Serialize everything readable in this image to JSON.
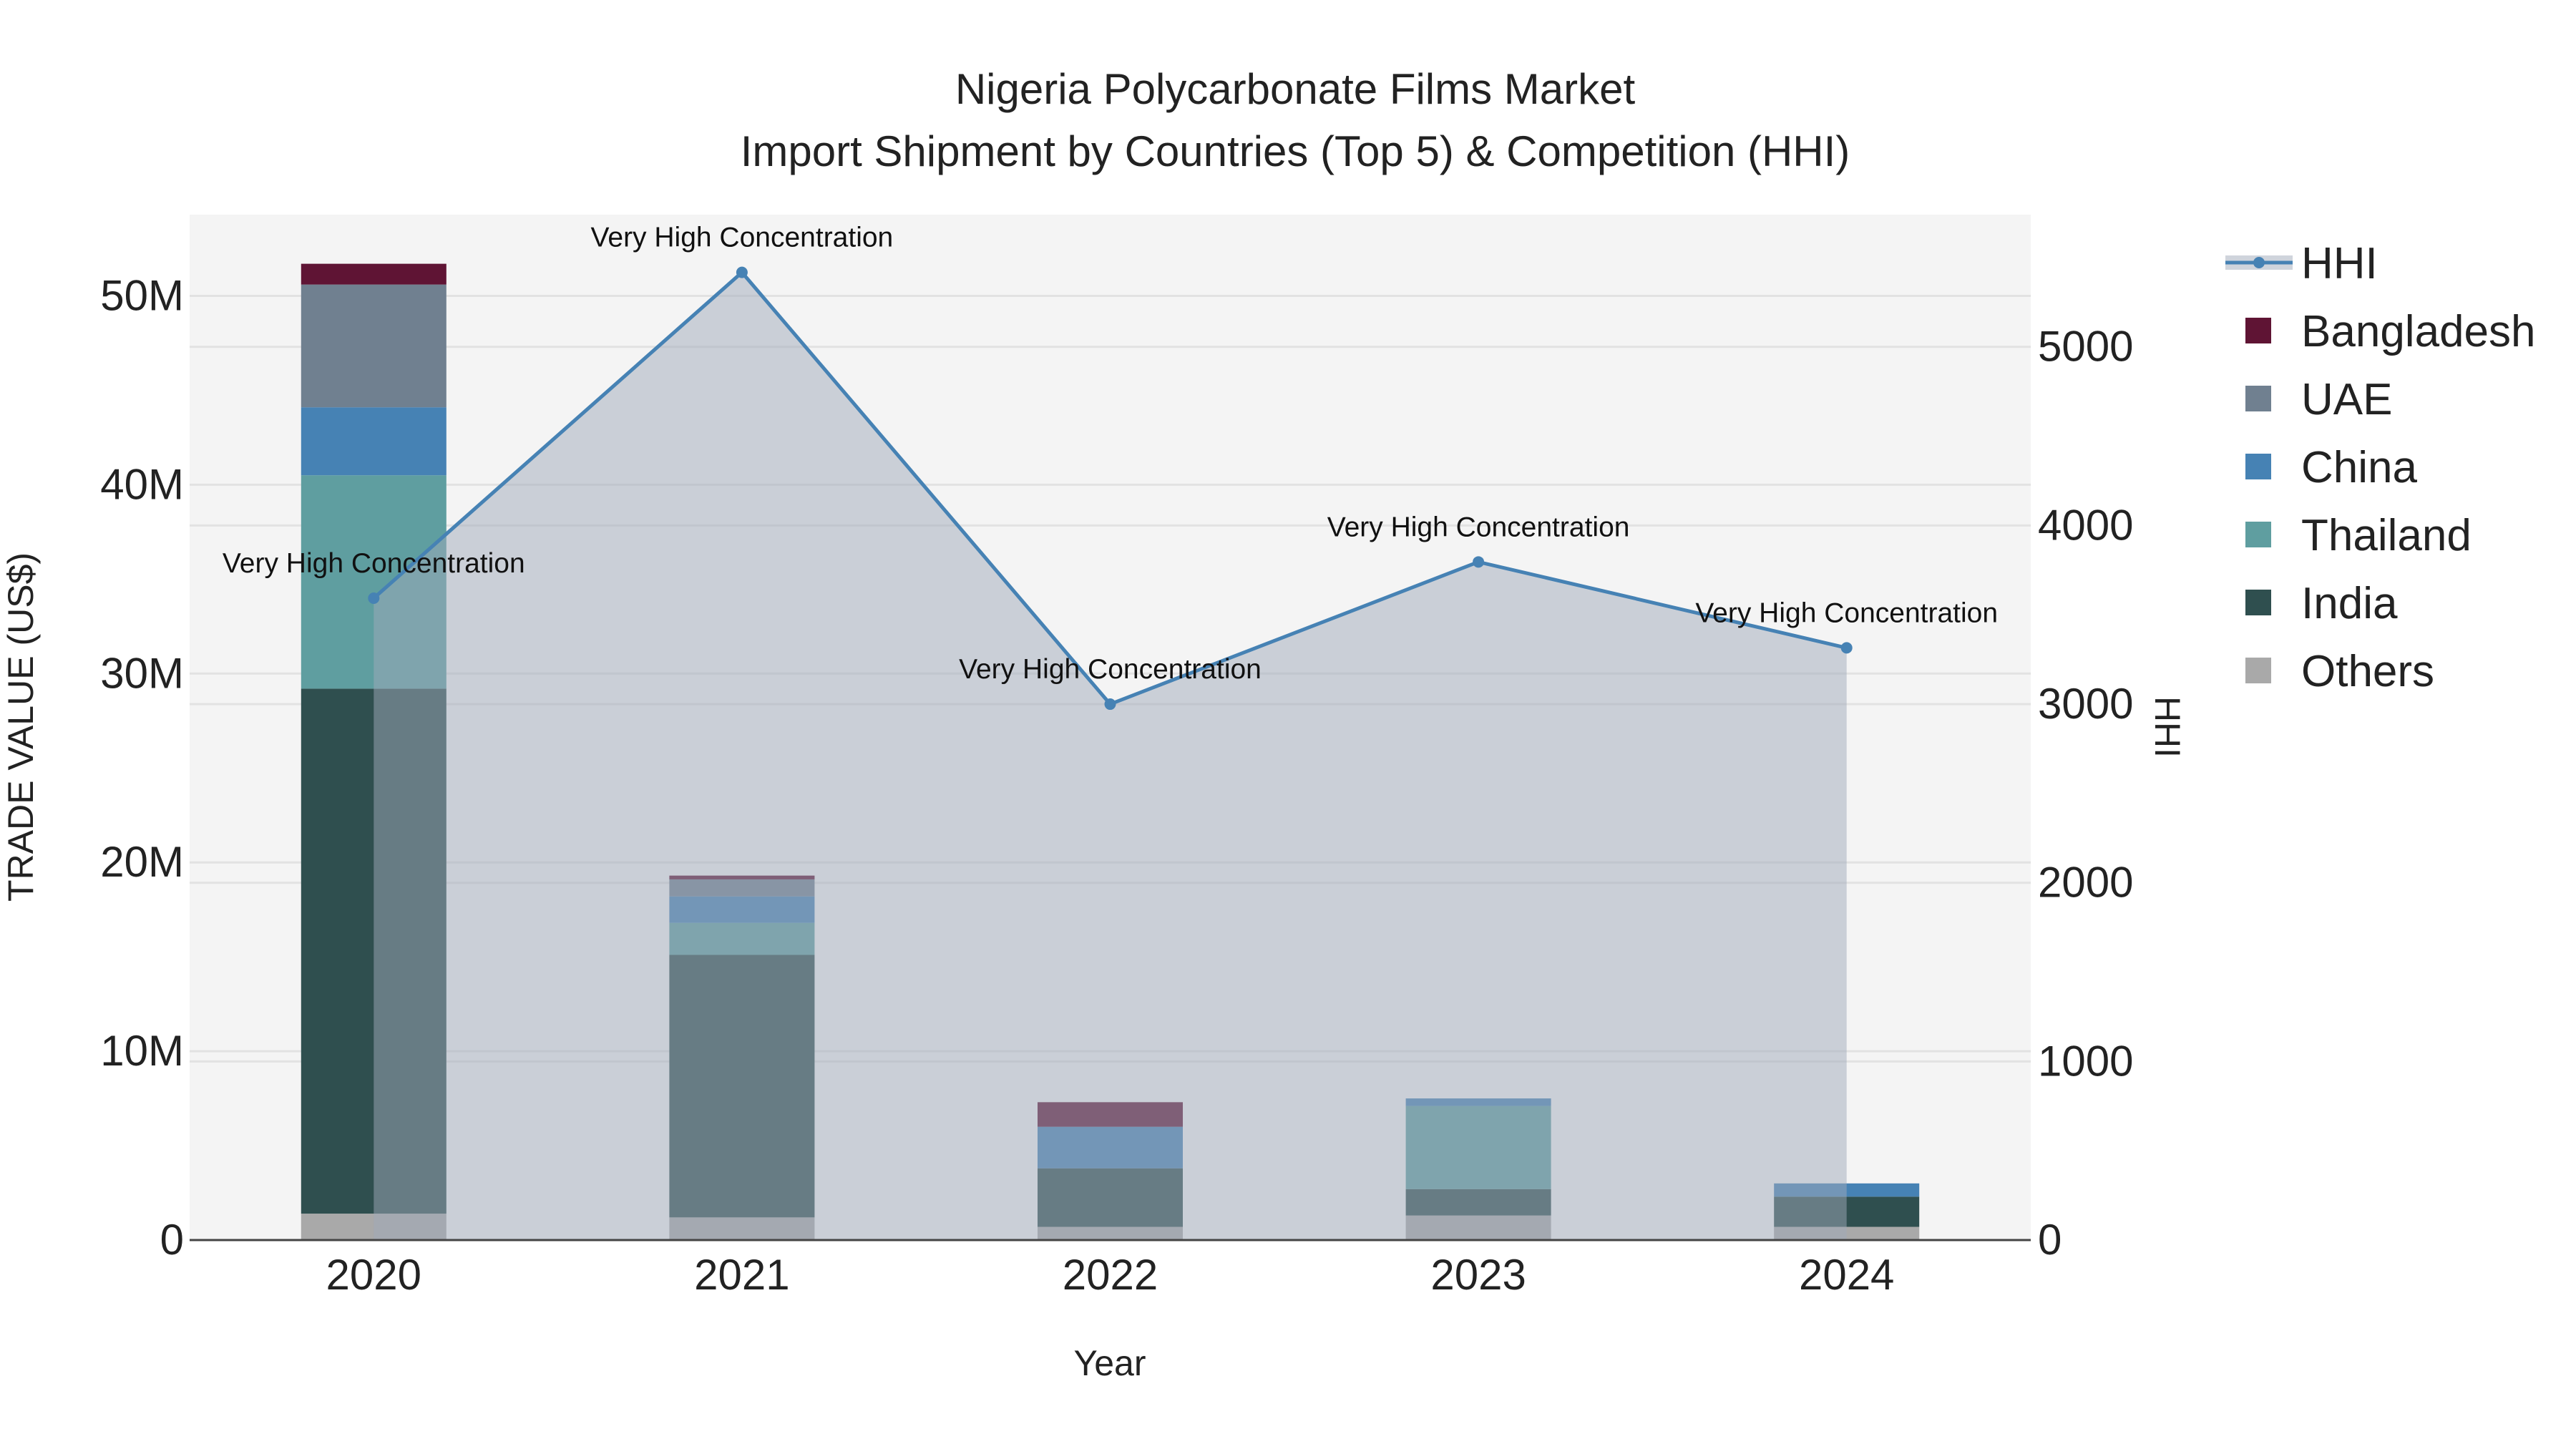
{
  "chart_data": {
    "type": "bar",
    "title": "Nigeria Polycarbonate Films Market",
    "subtitle": "Import Shipment by Countries (Top 5) & Competition (HHI)",
    "xlabel": "Year",
    "ylabel": "TRADE VALUE (US$)",
    "y2label": "HHI",
    "categories": [
      "2020",
      "2021",
      "2022",
      "2023",
      "2024"
    ],
    "ylim": [
      0,
      54300000
    ],
    "y2lim": [
      0,
      5740
    ],
    "yticks": [
      0,
      10000000,
      20000000,
      30000000,
      40000000,
      50000000
    ],
    "ytick_labels": [
      "0",
      "10M",
      "20M",
      "30M",
      "40M",
      "50M"
    ],
    "y2ticks": [
      0,
      1000,
      2000,
      3000,
      4000,
      5000
    ],
    "y2tick_labels": [
      "0",
      "1000",
      "2000",
      "3000",
      "4000",
      "5000"
    ],
    "series": [
      {
        "name": "Others",
        "color": "#a9a9a9",
        "values": [
          1400000,
          1200000,
          700000,
          1300000,
          700000
        ]
      },
      {
        "name": "India",
        "color": "#2f4f4f",
        "values": [
          27800000,
          13900000,
          3100000,
          1400000,
          1600000
        ]
      },
      {
        "name": "Thailand",
        "color": "#5f9ea0",
        "values": [
          11300000,
          1700000,
          0,
          4400000,
          0
        ]
      },
      {
        "name": "China",
        "color": "#4682b4",
        "values": [
          3600000,
          1400000,
          2200000,
          400000,
          700000
        ]
      },
      {
        "name": "UAE",
        "color": "#708090",
        "values": [
          6500000,
          900000,
          0,
          0,
          0
        ]
      },
      {
        "name": "Bangladesh",
        "color": "#5f1434",
        "values": [
          1100000,
          200000,
          1300000,
          0,
          0
        ]
      }
    ],
    "hhi": {
      "name": "HHI",
      "color": "#4682b4",
      "values": [
        3593,
        5417,
        3000,
        3796,
        3315
      ],
      "annotations": [
        "Very High Concentration",
        "Very High Concentration",
        "Very High Concentration",
        "Very High Concentration",
        "Very High Concentration"
      ]
    },
    "legend": [
      "HHI",
      "Bangladesh",
      "UAE",
      "China",
      "Thailand",
      "India",
      "Others"
    ],
    "legend_position": "right",
    "grid": true
  }
}
